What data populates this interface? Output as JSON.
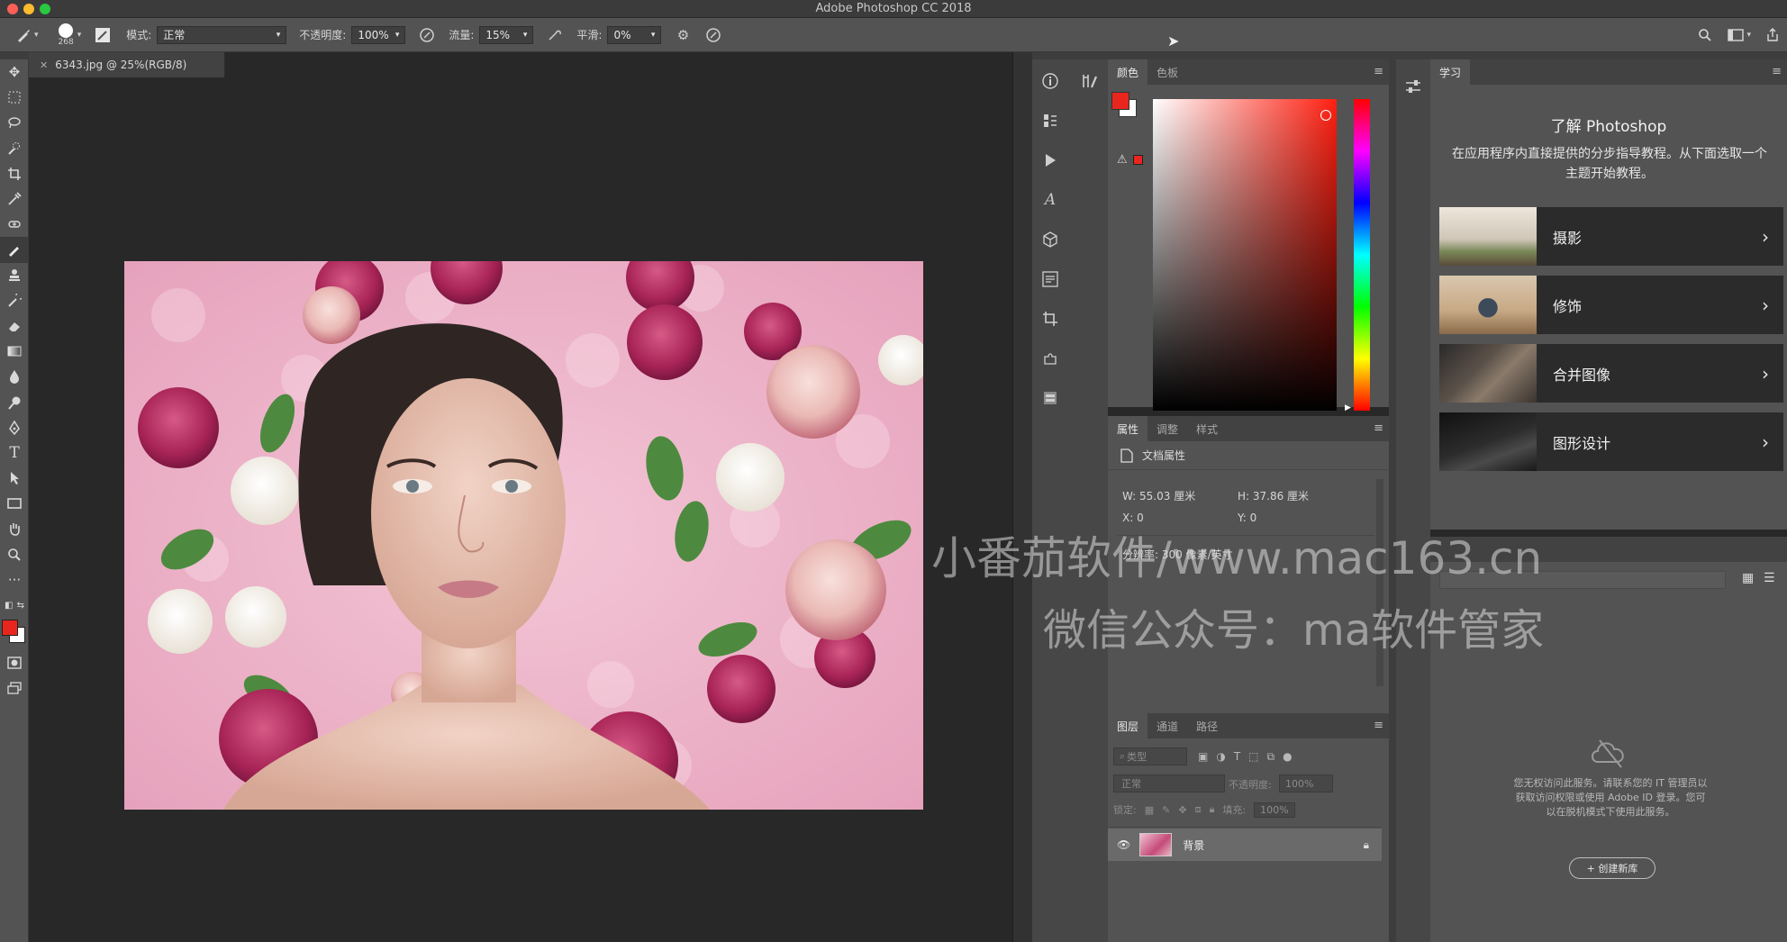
{
  "app": {
    "title": "Adobe Photoshop CC 2018"
  },
  "options": {
    "brush_size": "268",
    "mode_label": "模式:",
    "mode_value": "正常",
    "opacity_label": "不透明度:",
    "opacity_value": "100%",
    "flow_label": "流量:",
    "flow_value": "15%",
    "smoothing_label": "平滑:",
    "smoothing_value": "0%"
  },
  "document": {
    "tab_label": "6343.jpg @ 25%(RGB/8)"
  },
  "color_panel": {
    "tabs": [
      "颜色",
      "色板"
    ],
    "foreground": "#e8261e",
    "background": "#ffffff"
  },
  "properties_panel": {
    "tabs": [
      "属性",
      "调整",
      "样式"
    ],
    "section": "文档属性",
    "width": "W: 55.03 厘米",
    "height": "H: 37.86 厘米",
    "x": "X: 0",
    "y": "Y: 0",
    "resolution": "分辨率: 300 像素/英寸"
  },
  "layers_panel": {
    "tabs": [
      "图层",
      "通道",
      "路径"
    ],
    "filter_label": "类型",
    "blend_mode": "正常",
    "opacity_label": "不透明度:",
    "opacity_value": "100%",
    "lock_label": "锁定:",
    "fill_label": "填充:",
    "fill_value": "100%",
    "layer_name": "背景"
  },
  "learn_panel": {
    "tab": "学习",
    "heading": "了解 Photoshop",
    "description": "在应用程序内直接提供的分步指导教程。从下面选取一个主题开始教程。",
    "cards": [
      {
        "label": "摄影"
      },
      {
        "label": "修饰"
      },
      {
        "label": "合并图像"
      },
      {
        "label": "图形设计"
      }
    ]
  },
  "libraries_panel": {
    "message": "您无权访问此服务。请联系您的 IT 管理员以获取访问权限或使用 Adobe ID 登录。您可以在脱机模式下使用此服务。",
    "create_button": "+ 创建新库"
  },
  "watermark": {
    "line1": "小番茄软件/www.mac163.cn",
    "line2": "微信公众号：ma软件管家"
  }
}
